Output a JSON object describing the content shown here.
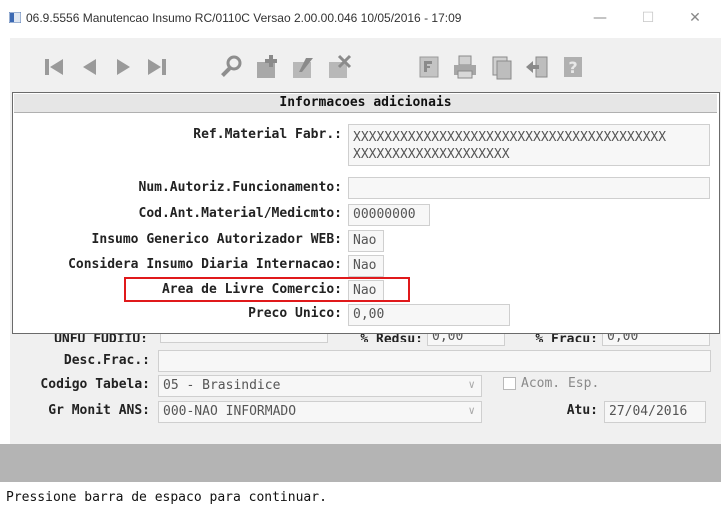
{
  "window": {
    "title": "06.9.5556 Manutencao  Insumo RC/0110C Versao 2.00.00.046 10/05/2016 - 17:09",
    "minimize_glyph": "—",
    "maximize_glyph": "☐",
    "close_glyph": "✕"
  },
  "toolbar": {
    "buttons": [
      "first-record",
      "previous-record",
      "next-record",
      "last-record",
      "search",
      "add",
      "edit",
      "delete",
      "filter",
      "print",
      "copy",
      "exit",
      "help"
    ]
  },
  "dialog": {
    "title": "Informacoes adicionais",
    "fields": {
      "ref_material": {
        "label": "Ref.Material Fabr.:",
        "line1": "XXXXXXXXXXXXXXXXXXXXXXXXXXXXXXXXXXXXXXXX",
        "line2": "XXXXXXXXXXXXXXXXXXXX"
      },
      "num_autoriz": {
        "label": "Num.Autoriz.Funcionamento:",
        "value": ""
      },
      "cod_ant": {
        "label": "Cod.Ant.Material/Medicmto:",
        "value": "00000000"
      },
      "insumo_generico": {
        "label": "Insumo Generico Autorizador WEB:",
        "value": "Nao"
      },
      "considera_insumo": {
        "label": "Considera Insumo Diaria Internacao:",
        "value": "Nao"
      },
      "area_livre": {
        "label": "Area de Livre Comercio:",
        "value": "Nao"
      },
      "preco_unico": {
        "label": "Preco Unico:",
        "value": "0,00"
      }
    }
  },
  "form": {
    "partial_row": {
      "label_a": "UNFU FUDIIU:",
      "label_b": "% Redsu:",
      "value_b": "0,00",
      "label_c": "% Fracu:",
      "value_c": "0,00"
    },
    "desc_frac": {
      "label": "Desc.Frac.:",
      "value": ""
    },
    "codigo_tabela": {
      "label": "Codigo Tabela:",
      "value": "05 - Brasindice"
    },
    "acom_esp": {
      "label": "Acom. Esp."
    },
    "gr_monit": {
      "label": "Gr Monit ANS:",
      "value": "000-NAO INFORMADO"
    },
    "atu": {
      "label": "Atu:",
      "value": "27/04/2016"
    }
  },
  "status": {
    "message": "Pressione barra de espaco para continuar."
  },
  "colors": {
    "highlight_border": "#e0191b",
    "dialog_title_bg": "#e6e6e6",
    "client_bg": "#f0f0f0"
  }
}
